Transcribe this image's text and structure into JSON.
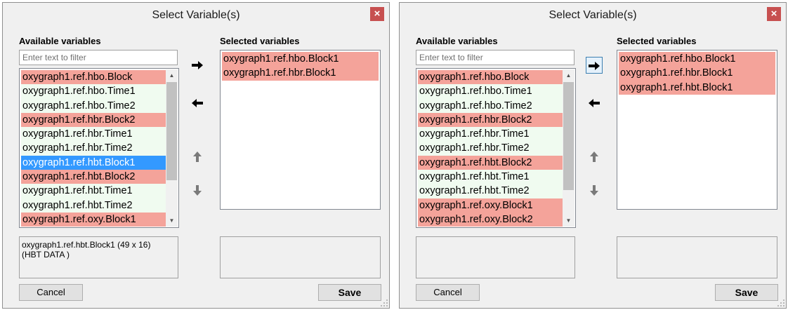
{
  "dialogs": [
    {
      "title": "Select Variable(s)",
      "close_glyph": "×",
      "available_label": "Available variables",
      "selected_label": "Selected variables",
      "filter_placeholder": "Enter text to filter",
      "available_items": [
        {
          "text": "oxygraph1.ref.hbo.Block",
          "state": "red"
        },
        {
          "text": "oxygraph1.ref.hbo.Time1",
          "state": "green"
        },
        {
          "text": "oxygraph1.ref.hbo.Time2",
          "state": "green"
        },
        {
          "text": "oxygraph1.ref.hbr.Block2",
          "state": "red"
        },
        {
          "text": "oxygraph1.ref.hbr.Time1",
          "state": "green"
        },
        {
          "text": "oxygraph1.ref.hbr.Time2",
          "state": "green"
        },
        {
          "text": "oxygraph1.ref.hbt.Block1",
          "state": "selected"
        },
        {
          "text": "oxygraph1.ref.hbt.Block2",
          "state": "red"
        },
        {
          "text": "oxygraph1.ref.hbt.Time1",
          "state": "green"
        },
        {
          "text": "oxygraph1.ref.hbt.Time2",
          "state": "green"
        },
        {
          "text": "oxygraph1.ref.oxy.Block1",
          "state": "red"
        }
      ],
      "selected_items": [
        {
          "text": "oxygraph1.ref.hbo.Block1",
          "state": "red"
        },
        {
          "text": "oxygraph1.ref.hbr.Block1",
          "state": "red"
        }
      ],
      "info_lines": [
        "oxygraph1.ref.hbt.Block1 (49 x 16)",
        "(HBT DATA )"
      ],
      "cancel_label": "Cancel",
      "save_label": "Save",
      "add_focused": false
    },
    {
      "title": "Select Variable(s)",
      "close_glyph": "×",
      "available_label": "Available variables",
      "selected_label": "Selected variables",
      "filter_placeholder": "Enter text to filter",
      "available_items": [
        {
          "text": "oxygraph1.ref.hbo.Block",
          "state": "red"
        },
        {
          "text": "oxygraph1.ref.hbo.Time1",
          "state": "green"
        },
        {
          "text": "oxygraph1.ref.hbo.Time2",
          "state": "green"
        },
        {
          "text": "oxygraph1.ref.hbr.Block2",
          "state": "red"
        },
        {
          "text": "oxygraph1.ref.hbr.Time1",
          "state": "green"
        },
        {
          "text": "oxygraph1.ref.hbr.Time2",
          "state": "green"
        },
        {
          "text": "oxygraph1.ref.hbt.Block2",
          "state": "red"
        },
        {
          "text": "oxygraph1.ref.hbt.Time1",
          "state": "green"
        },
        {
          "text": "oxygraph1.ref.hbt.Time2",
          "state": "green"
        },
        {
          "text": "oxygraph1.ref.oxy.Block1",
          "state": "red"
        },
        {
          "text": "oxygraph1.ref.oxy.Block2",
          "state": "red"
        }
      ],
      "selected_items": [
        {
          "text": "oxygraph1.ref.hbo.Block1",
          "state": "red"
        },
        {
          "text": "oxygraph1.ref.hbr.Block1",
          "state": "red"
        },
        {
          "text": "oxygraph1.ref.hbt.Block1",
          "state": "red"
        }
      ],
      "info_lines": [],
      "cancel_label": "Cancel",
      "save_label": "Save",
      "add_focused": true
    }
  ],
  "icons": {
    "add": "arrow-right-icon",
    "remove": "arrow-left-icon",
    "move_up": "arrow-up-icon",
    "move_down": "arrow-down-icon",
    "scroll_up": "scroll-up-icon",
    "scroll_down": "scroll-down-icon",
    "close": "close-icon"
  },
  "colors": {
    "variable_highlight": "#f4a39a",
    "variable_normal": "#f0fbf0",
    "selection": "#3399ff",
    "close_button": "#c75050"
  }
}
